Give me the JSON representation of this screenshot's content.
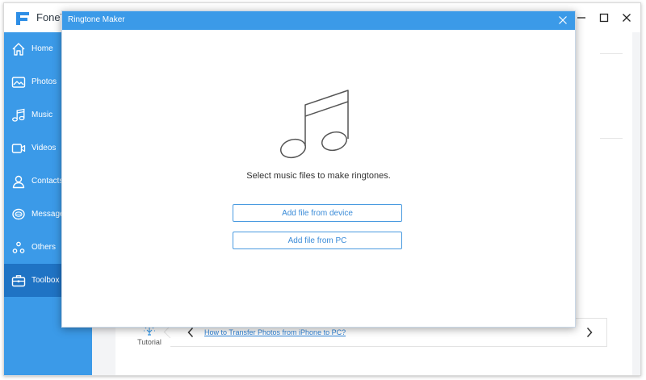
{
  "app": {
    "name": "FoneT"
  },
  "sidebar": {
    "items": [
      {
        "label": "Home",
        "icon": "home-icon"
      },
      {
        "label": "Photos",
        "icon": "photos-icon"
      },
      {
        "label": "Music",
        "icon": "music-icon"
      },
      {
        "label": "Videos",
        "icon": "videos-icon"
      },
      {
        "label": "Contacts",
        "icon": "contacts-icon"
      },
      {
        "label": "Messages",
        "icon": "messages-icon"
      },
      {
        "label": "Others",
        "icon": "others-icon"
      },
      {
        "label": "Toolbox",
        "icon": "toolbox-icon",
        "active": true
      }
    ]
  },
  "tutorial": {
    "label": "Tutorial",
    "link": "How to Transfer Photos from iPhone to PC?"
  },
  "dialog": {
    "title": "Ringtone Maker",
    "prompt": "Select music files to make ringtones.",
    "add_device_label": "Add file from device",
    "add_pc_label": "Add file from PC"
  },
  "colors": {
    "accent": "#3b9ae8",
    "sidebar_active": "#1f73c4",
    "link": "#2f83d6"
  }
}
